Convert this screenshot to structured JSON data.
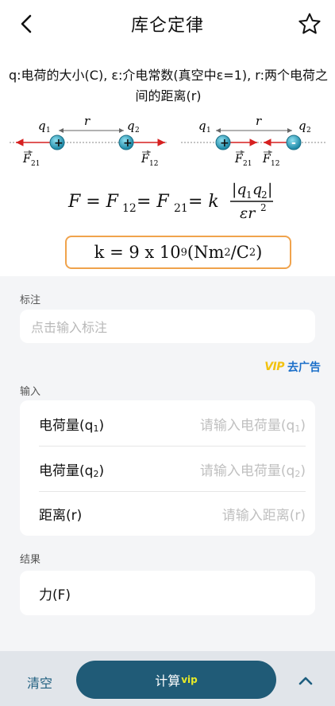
{
  "header": {
    "title": "库仑定律",
    "back_icon": "chevron-left-icon",
    "favorite_icon": "star-icon"
  },
  "formula_panel": {
    "description": "q:电荷的大小(C), ε:介电常数(真空中ε=1), r:两个电荷之间的距离(r)",
    "diagram_left": {
      "q1": "q",
      "q1_sub": "1",
      "q2": "q",
      "q2_sub": "2",
      "r": "r",
      "f_left": "F",
      "f_left_sub": "21",
      "f_right": "F",
      "f_right_sub": "12",
      "charge1": "+",
      "charge2": "+"
    },
    "diagram_right": {
      "q1": "q",
      "q1_sub": "1",
      "q2": "q",
      "q2_sub": "2",
      "r": "r",
      "f_left": "F",
      "f_left_sub": "21",
      "f_right": "F",
      "f_right_sub": "12",
      "charge1": "+",
      "charge2": "-"
    },
    "formula_lhs": "F = F",
    "formula_sub12": "12",
    "formula_eq": " = F",
    "formula_sub21": "21",
    "formula_eq_k": " = k",
    "numerator": "|q",
    "num_sub1": "1",
    "num_q2": "q",
    "num_sub2": "2",
    "num_close": "|",
    "denominator": "εr",
    "den_exp": "2",
    "k_value": "k = 9 x 10",
    "k_exp": "9",
    "k_units": " (Nm",
    "k_units_exp": "2",
    "k_units_mid": "/C",
    "k_units_exp2": "2",
    "k_units_close": ")"
  },
  "note": {
    "section_label": "标注",
    "placeholder": "点击输入标注"
  },
  "ad": {
    "vip_label": "VIP",
    "link_text": "去广告",
    "accent": "#1b6fc9"
  },
  "inputs": {
    "section_label": "输入",
    "rows": [
      {
        "label": "电荷量(q",
        "label_sub": "1",
        "label_close": ")",
        "placeholder": "请输入电荷量(q",
        "ph_sub": "1",
        "ph_close": ")"
      },
      {
        "label": "电荷量(q",
        "label_sub": "2",
        "label_close": ")",
        "placeholder": "请输入电荷量(q",
        "ph_sub": "2",
        "ph_close": ")"
      },
      {
        "label": "距离(r)",
        "label_sub": "",
        "label_close": "",
        "placeholder": "请输入距离(r)",
        "ph_sub": "",
        "ph_close": ""
      }
    ]
  },
  "result": {
    "section_label": "结果",
    "label": "力(F)"
  },
  "bottom": {
    "clear_label": "清空",
    "calc_label": "计算",
    "calc_sup": "vip",
    "expand_icon": "chevron-up-icon",
    "button_color": "#205b77"
  }
}
